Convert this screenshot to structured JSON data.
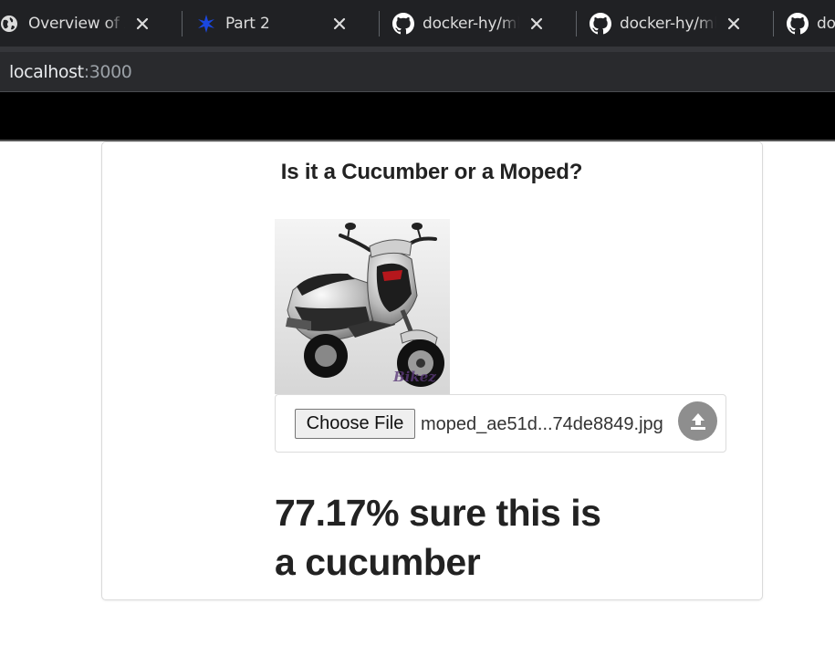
{
  "browser": {
    "tabs": [
      {
        "title": "Overview of An",
        "icon": "globe-icon",
        "close": "✕"
      },
      {
        "title": "Part 2",
        "icon": "app-logo-icon",
        "close": "✕"
      },
      {
        "title": "docker-hy/ml-k",
        "icon": "github-icon",
        "close": "✕"
      },
      {
        "title": "docker-hy/ml-k",
        "icon": "github-icon",
        "close": "✕"
      },
      {
        "title": "do",
        "icon": "github-icon"
      }
    ],
    "address": {
      "host": "localhost",
      "port": ":3000"
    }
  },
  "app": {
    "title": "Is it a Cucumber or a Moped?",
    "upload": {
      "choose_label": "Choose File",
      "filename": "moped_ae51d...74de8849.jpg",
      "upload_icon": "upload-icon"
    },
    "result": "77.17% sure this is a cucumber",
    "image_watermark": "Bikez"
  },
  "colors": {
    "tabbar_bg": "#202124",
    "addressbar_bg": "#292a2d",
    "page_topbar": "#000000",
    "upload_button": "#8e8e8e",
    "text": "#222222"
  }
}
